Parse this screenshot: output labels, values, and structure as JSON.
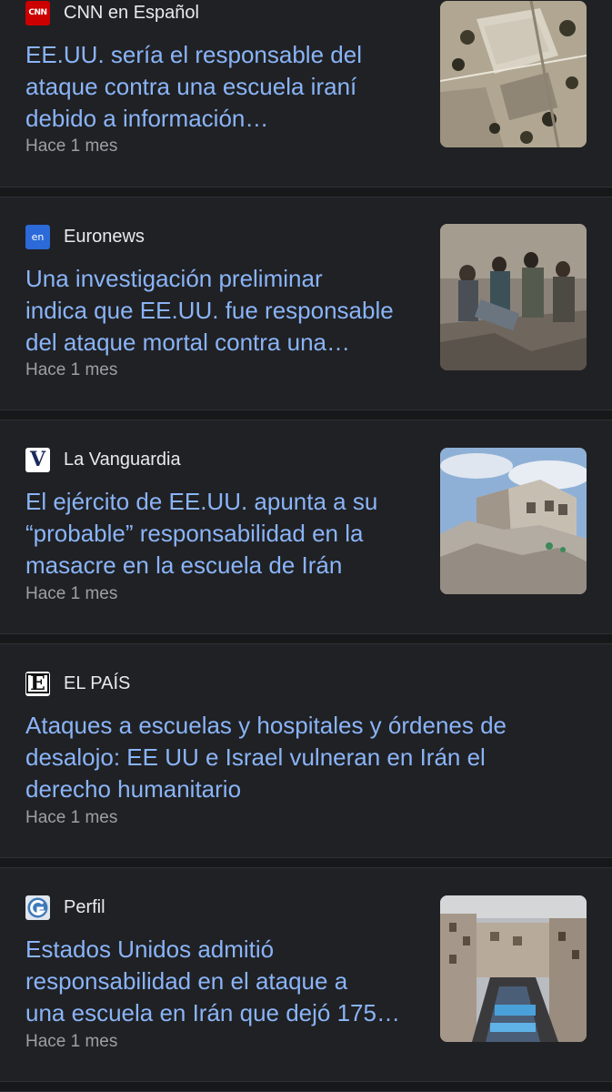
{
  "articles": [
    {
      "source": "CNN en Español",
      "logo_icon": "cnn-logo-icon",
      "logo_text": "CNN",
      "headline_lines": [
        "EE.UU. sería el responsable del",
        "ataque contra una escuela iraní",
        "debido a información…"
      ],
      "time": "Hace 1 mes",
      "thumbnail": "aerial-view-of-school-image"
    },
    {
      "source": "Euronews",
      "logo_icon": "euronews-logo-icon",
      "logo_text": "en",
      "headline_lines": [
        "Una investigación preliminar",
        "indica que EE.UU. fue responsable",
        "del ataque mortal contra una…"
      ],
      "time": "Hace 1 mes",
      "thumbnail": "people-searching-rubble-image"
    },
    {
      "source": "La Vanguardia",
      "logo_icon": "la-vanguardia-logo-icon",
      "logo_text": "V",
      "headline_lines": [
        "El ejército de EE.UU. apunta a su",
        "“probable” responsabilidad en la",
        "masacre en la escuela de Irán"
      ],
      "time": "Hace 1 mes",
      "thumbnail": "destroyed-building-image"
    },
    {
      "source": "EL PAÍS",
      "logo_icon": "el-pais-logo-icon",
      "logo_text": "E",
      "headline_lines": [
        "Ataques a escuelas y hospitales y órdenes de",
        "desalojo: EE UU e Israel vulneran en Irán el",
        "derecho humanitario"
      ],
      "time": "Hace 1 mes",
      "thumbnail": null
    },
    {
      "source": "Perfil",
      "logo_icon": "perfil-logo-icon",
      "logo_text": "",
      "headline_lines": [
        "Estados Unidos admitió",
        "responsabilidad en el ataque a",
        "una escuela en Irán que dejó 175…"
      ],
      "time": "Hace 1 mes",
      "thumbnail": "crowded-street-funeral-image"
    }
  ],
  "colors": {
    "background": "#202124",
    "separator": "#17181a",
    "headline": "#8ab4f8",
    "source": "#e8eaed",
    "time": "#9aa0a6"
  }
}
